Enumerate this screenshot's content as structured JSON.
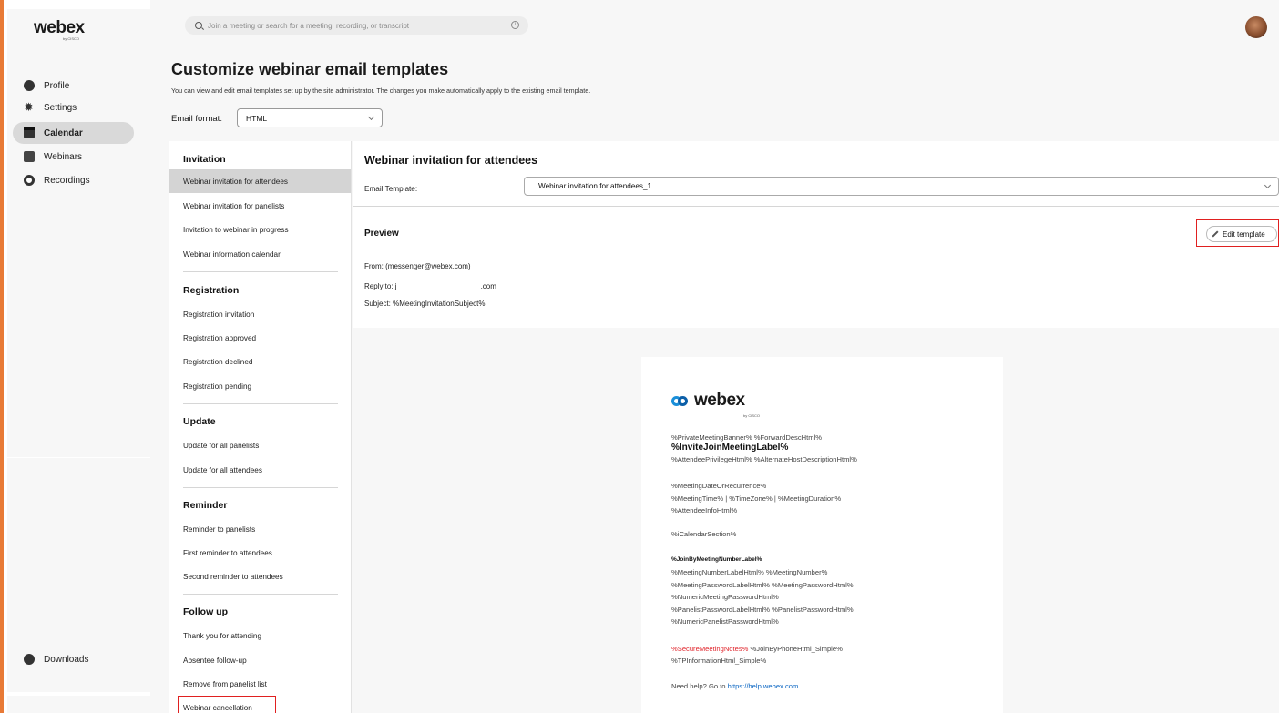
{
  "brand": {
    "logo": "webex",
    "logo_sub": "by CISCO"
  },
  "search": {
    "placeholder": "Join a meeting or search for a meeting, recording, or transcript",
    "info_icon": "info-icon"
  },
  "nav": {
    "items": [
      {
        "label": "Profile",
        "icon": "profile-icon"
      },
      {
        "label": "Settings",
        "icon": "gear-icon"
      },
      {
        "label": "Calendar",
        "icon": "calendar-icon",
        "active": true
      },
      {
        "label": "Webinars",
        "icon": "webinar-icon"
      },
      {
        "label": "Recordings",
        "icon": "recording-icon"
      }
    ],
    "downloads": "Downloads"
  },
  "page": {
    "title": "Customize webinar email templates",
    "description": "You can view and edit email templates set up by the site administrator. The changes you make automatically apply to the existing email template.",
    "format_label": "Email format:",
    "format_value": "HTML"
  },
  "template_groups": {
    "invitation": {
      "heading": "Invitation",
      "items": [
        "Webinar invitation for attendees",
        "Webinar invitation for panelists",
        "Invitation to webinar in progress",
        "Webinar information calendar"
      ]
    },
    "registration": {
      "heading": "Registration",
      "items": [
        "Registration invitation",
        "Registration approved",
        "Registration declined",
        "Registration pending"
      ]
    },
    "update": {
      "heading": "Update",
      "items": [
        "Update for all panelists",
        "Update for all attendees"
      ]
    },
    "reminder": {
      "heading": "Reminder",
      "items": [
        "Reminder to panelists",
        "First reminder to attendees",
        "Second reminder to attendees"
      ]
    },
    "follow_up": {
      "heading": "Follow up",
      "items": [
        "Thank you for attending",
        "Absentee follow-up",
        "Remove from panelist list",
        "Webinar cancellation"
      ]
    }
  },
  "detail": {
    "title": "Webinar invitation for attendees",
    "template_label": "Email Template:",
    "template_value": "Webinar invitation for attendees_1",
    "preview_label": "Preview",
    "edit_button": "Edit template",
    "from": "From: (messenger@webex.com)",
    "reply_to_prefix": "Reply to: j",
    "reply_to_suffix": ".com",
    "subject": "Subject: %MeetingInvitationSubject%"
  },
  "email_preview": {
    "logo": "webex",
    "logo_sub": "by CISCO",
    "line1": "%PrivateMeetingBanner% %ForwardDescHtml%",
    "line2": "%InviteJoinMeetingLabel%",
    "line3": "%AttendeePrivilegeHtml% %AlternateHostDescriptionHtml%",
    "line4": "%MeetingDateOrRecurrence%",
    "line5": "%MeetingTime% | %TimeZone% | %MeetingDuration%",
    "line6": "%AttendeeInfoHtml%",
    "line7": "%iCalendarSection%",
    "line8": "%JoinByMeetingNumberLabel%",
    "line9": "%MeetingNumberLabelHtml% %MeetingNumber%",
    "line10": "%MeetingPasswordLabelHtml% %MeetingPasswordHtml%",
    "line11": "%NumericMeetingPasswordHtml%",
    "line12": "%PanelistPasswordLabelHtml% %PanelistPasswordHtml%",
    "line13": "%NumericPanelistPasswordHtml%",
    "line14_red": "%SecureMeetingNotes%",
    "line14_rest": " %JoinByPhoneHtml_Simple%",
    "line15": "%TPInformationHtml_Simple%",
    "help_prefix": "Need help? Go to ",
    "help_link": "https://help.webex.com"
  },
  "colors": {
    "accent_strip": "#e87a36",
    "highlight_box": "#e02020",
    "link": "#0b66c3",
    "selected_row": "#d4d4d4"
  }
}
